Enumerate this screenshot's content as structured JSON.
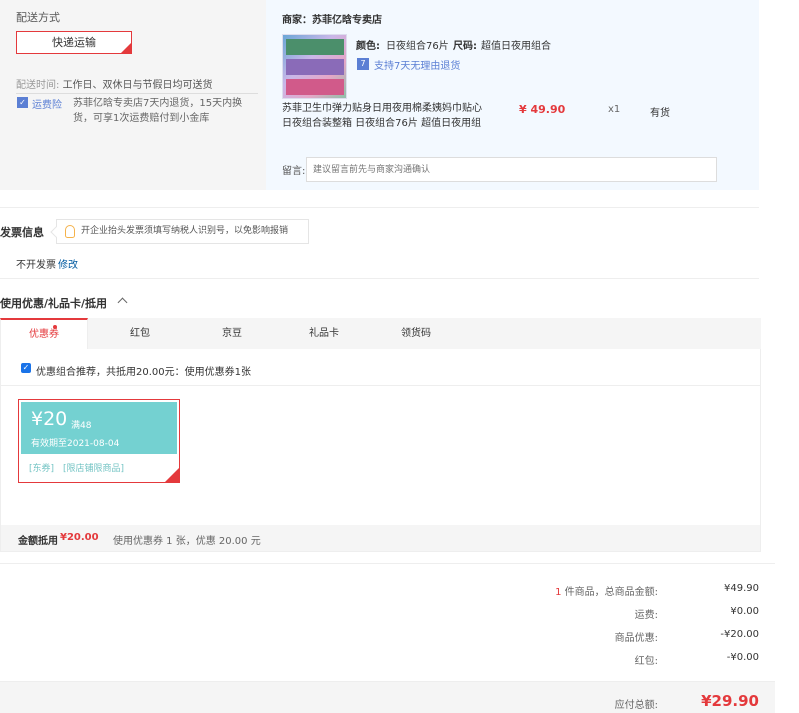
{
  "shipping": {
    "title": "配送方式",
    "method": "快递运输",
    "time_label": "配送时间:",
    "time_value": "工作日、双休日与节假日均可送货",
    "insurance_icon": "shield-icon",
    "insurance_label": "运费险",
    "insurance_desc": "苏菲亿晗专卖店7天内退货，15天内换货，可享1次运费赔付到小金库"
  },
  "shop": {
    "name": "商家：苏菲亿晗专卖店",
    "color_label": "颜色:",
    "color_value": "日夜组合76片",
    "size_label": "尺码:",
    "size_value": "超值日夜用组合",
    "return_icon": "seven-day-return-icon",
    "return_text": "支持7天无理由退货",
    "product_name": "苏菲卫生巾弹力贴身日用夜用棉柔姨妈巾贴心日夜组合装整箱 日夜组合76片 超值日夜用组",
    "price": "¥ 49.90",
    "qty": "x1",
    "stock": "有货",
    "message_label": "留言:",
    "message_placeholder": "建议留言前先与商家沟通确认"
  },
  "invoice": {
    "title": "发票信息",
    "tip_icon": "lightbulb-icon",
    "tip": "开企业抬头发票须填写纳税人识别号，以免影响报销",
    "status": "不开发票",
    "edit": "修改"
  },
  "coupon": {
    "title": "使用优惠/礼品卡/抵用",
    "tabs": [
      {
        "label": "优惠券",
        "active": true
      },
      {
        "label": "红包"
      },
      {
        "label": "京豆"
      },
      {
        "label": "礼品卡"
      },
      {
        "label": "领货码"
      }
    ],
    "recommend": "优惠组合推荐，共抵用20.00元：使用优惠券1张",
    "card": {
      "amount": "¥20",
      "condition": "满48",
      "expiry": "有效期至2021-08-04",
      "tag1": "[东券]",
      "tag2": "[限店铺限商品]"
    },
    "summary_label": "金额抵用",
    "summary_value": "¥20.00",
    "summary_desc": "使用优惠券 1 张，优惠 20.00 元"
  },
  "totals": {
    "count": "1",
    "count_suffix": " 件商品，总商品金额:",
    "goods_value": "¥49.90",
    "shipping_label": "运费:",
    "shipping_value": "¥0.00",
    "discount_label": "商品优惠:",
    "discount_value": "-¥20.00",
    "redpacket_label": "红包:",
    "redpacket_value": "-¥0.00",
    "pay_label": "应付总额:",
    "pay_value": "¥29.90"
  }
}
